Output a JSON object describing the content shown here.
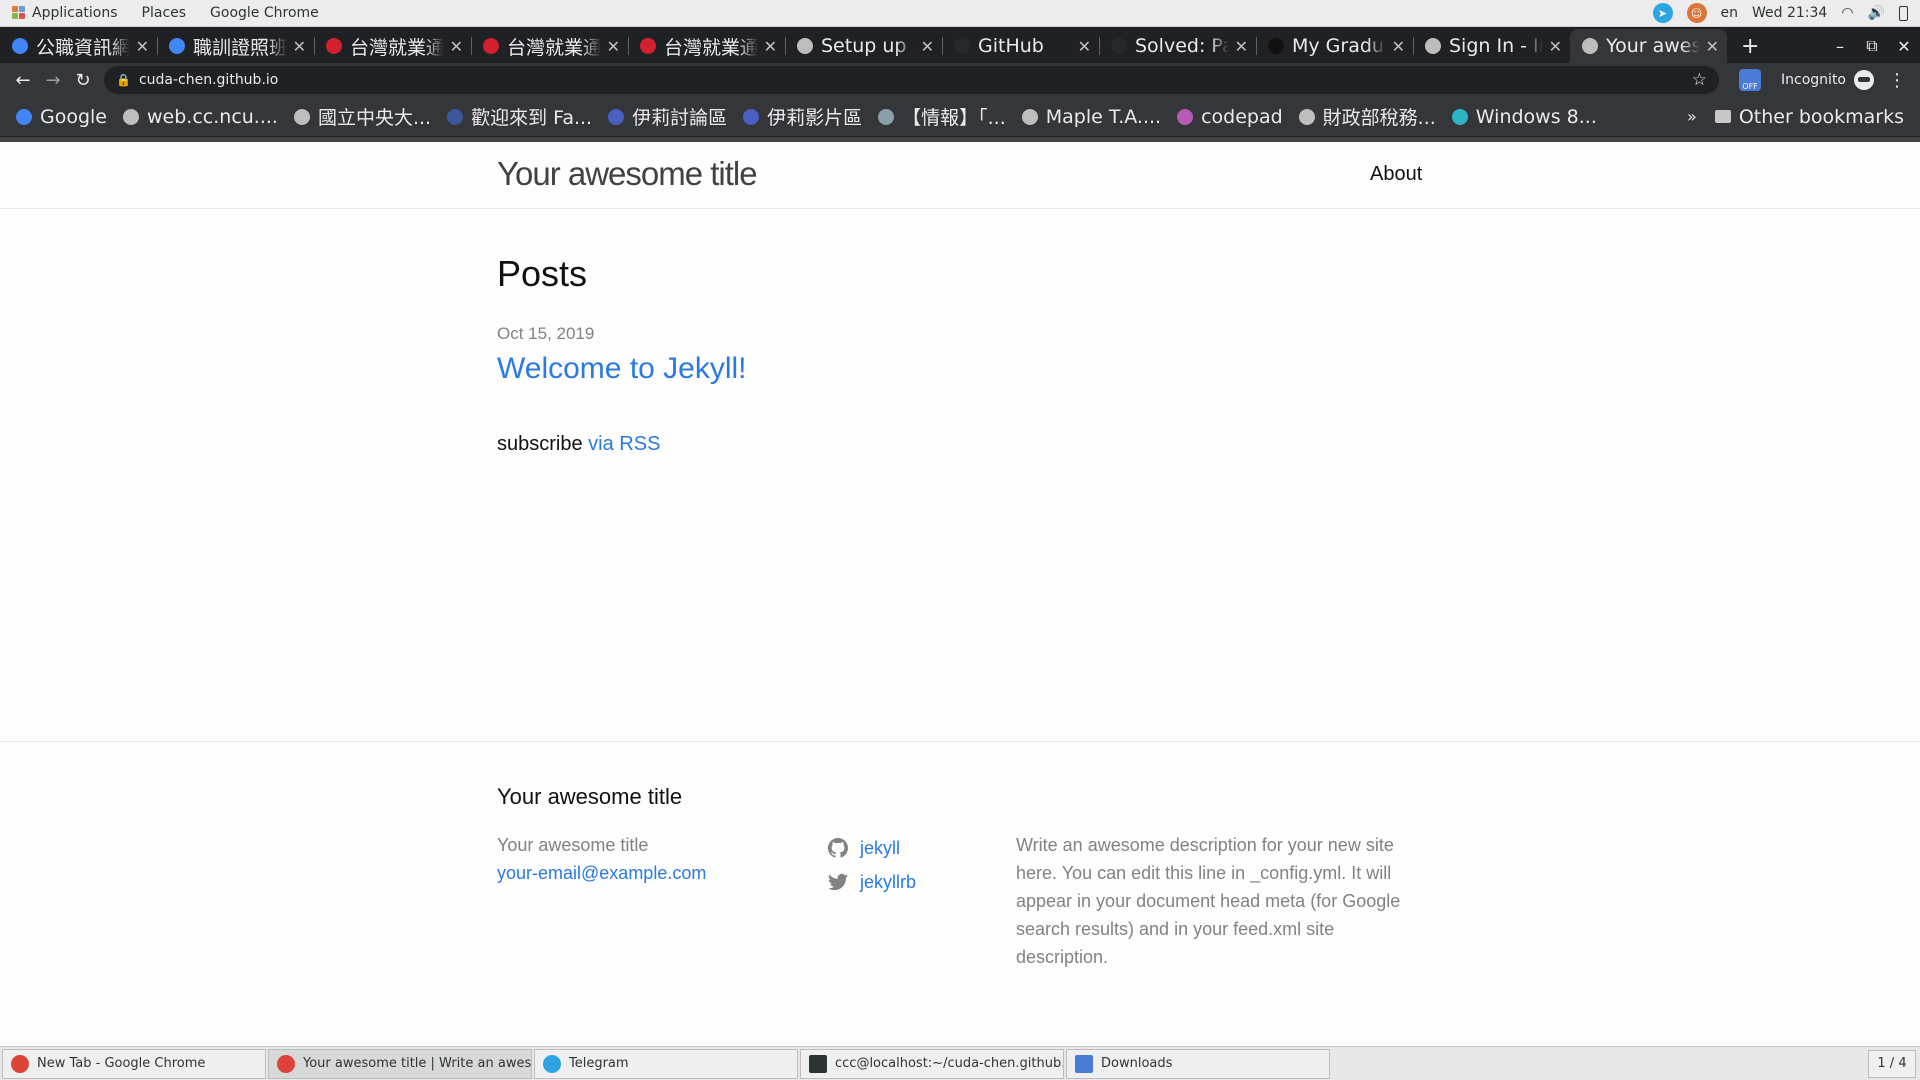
{
  "topbar": {
    "menus": [
      "Applications",
      "Places",
      "Google Chrome"
    ],
    "language": "en",
    "clock": "Wed 21:34"
  },
  "tabs": [
    {
      "title": "公職資訊網",
      "favicon": "google-icon",
      "color": "#4285f4"
    },
    {
      "title": "職訓證照班",
      "favicon": "google-icon",
      "color": "#4285f4"
    },
    {
      "title": "台灣就業通",
      "favicon": "taiwan-jobs-icon",
      "color": "#d3202f"
    },
    {
      "title": "台灣就業通",
      "favicon": "taiwan-jobs-icon",
      "color": "#d3202f"
    },
    {
      "title": "台灣就業通",
      "favicon": "taiwan-jobs-icon",
      "color": "#d3202f"
    },
    {
      "title": "Setup up a",
      "favicon": "globe-icon",
      "color": "#bdbdbd"
    },
    {
      "title": "GitHub",
      "favicon": "github-icon",
      "color": "#24292e"
    },
    {
      "title": "Solved: Pa",
      "favicon": "github-icon",
      "color": "#24292e"
    },
    {
      "title": "My Gradua",
      "favicon": "document-icon",
      "color": "#111111"
    },
    {
      "title": "Sign In - In",
      "favicon": "loading-icon",
      "color": "#bdbdbd"
    },
    {
      "title": "Your awes",
      "favicon": "globe-icon",
      "color": "#bdbdbd",
      "active": true
    }
  ],
  "omnibox": {
    "url": "cuda-chen.github.io",
    "incognito_label": "Incognito"
  },
  "bookmarks": [
    {
      "label": "Google",
      "icon": "google-icon",
      "color": "#4285f4"
    },
    {
      "label": "web.cc.ncu....",
      "icon": "globe-icon",
      "color": "#bdbdbd"
    },
    {
      "label": "國立中央大...",
      "icon": "globe-icon",
      "color": "#bdbdbd"
    },
    {
      "label": "歡迎來到 Fa...",
      "icon": "facebook-icon",
      "color": "#3b5998"
    },
    {
      "label": "伊莉討論區",
      "icon": "eyny-icon",
      "color": "#4a5fc1"
    },
    {
      "label": "伊莉影片區",
      "icon": "eyny-icon",
      "color": "#4a5fc1"
    },
    {
      "label": "【情報】「...",
      "icon": "bahamut-icon",
      "color": "#8aa0a8"
    },
    {
      "label": "Maple T.A....",
      "icon": "globe-icon",
      "color": "#bdbdbd"
    },
    {
      "label": "codepad",
      "icon": "codepad-icon",
      "color": "#b55bb5"
    },
    {
      "label": "財政部稅務...",
      "icon": "globe-icon",
      "color": "#bdbdbd"
    },
    {
      "label": "Windows 8...",
      "icon": "windows-icon",
      "color": "#2bb5c5"
    }
  ],
  "other_bookmarks": "Other bookmarks",
  "page": {
    "site_title": "Your awesome title",
    "nav_about": "About",
    "posts_heading": "Posts",
    "post_date": "Oct 15, 2019",
    "post_title": "Welcome to Jekyll!",
    "subscribe_text": "subscribe",
    "subscribe_link": "via RSS",
    "link_color": "#2a7ae2"
  },
  "footer": {
    "heading": "Your awesome title",
    "name": "Your awesome title",
    "email": "your-email@example.com",
    "github": "jekyll",
    "twitter": "jekyllrb",
    "description": "Write an awesome description for your new site here. You can edit this line in _config.yml. It will appear in your document head meta (for Google search results) and in your feed.xml site description."
  },
  "taskbar": {
    "items": [
      {
        "label": "New Tab - Google Chrome",
        "icon": "chrome-icon"
      },
      {
        "label": "Your awesome title | Write an awes...",
        "icon": "chrome-icon",
        "active": true
      },
      {
        "label": "Telegram",
        "icon": "telegram-icon"
      },
      {
        "label": "ccc@localhost:~/cuda-chen.github.io",
        "icon": "terminal-icon"
      },
      {
        "label": "Downloads",
        "icon": "files-icon"
      }
    ],
    "workspace": "1 / 4"
  }
}
